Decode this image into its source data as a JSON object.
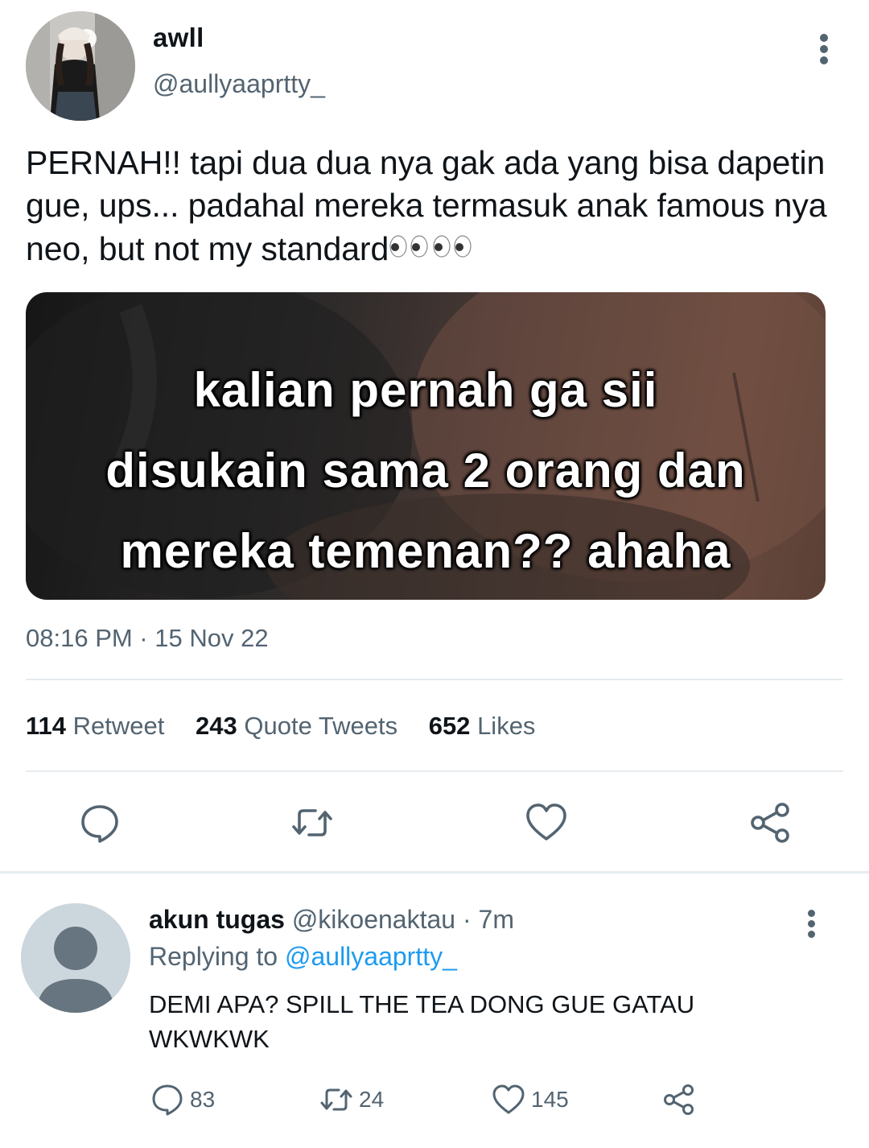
{
  "tweet": {
    "display_name": "awll",
    "handle": "@aullyaaprtty_",
    "text": "PERNAH!! tapi dua dua nya gak ada yang bisa dapetin gue, ups... padahal mereka termasuk anak famous nya neo, but not my standard",
    "emoji": "eyes-emoji x4",
    "media_caption": [
      "kalian pernah ga sii",
      "disukain sama 2 orang dan",
      "mereka temenan?? ahaha"
    ],
    "timestamp": "08:16 PM · 15 Nov 22",
    "stats": {
      "retweets_count": "114",
      "retweets_label": "Retweet",
      "quotes_count": "243",
      "quotes_label": "Quote Tweets",
      "likes_count": "652",
      "likes_label": "Likes"
    },
    "actions": [
      "reply-icon",
      "retweet-icon",
      "like-icon",
      "share-icon"
    ]
  },
  "reply": {
    "display_name": "akun tugas",
    "handle": "@kikoenaktau",
    "time": "· 7m",
    "replying_prefix": "Replying to",
    "replying_to": "@aullyaaprtty_",
    "text": "DEMI APA? SPILL THE TEA DONG GUE GATAU WKWKWK",
    "reply_count": "83",
    "retweet_count": "24",
    "like_count": "145"
  },
  "colors": {
    "text_primary": "#0f1419",
    "text_secondary": "#536471",
    "link": "#1d9bf0",
    "divider": "#e6ecf0"
  }
}
